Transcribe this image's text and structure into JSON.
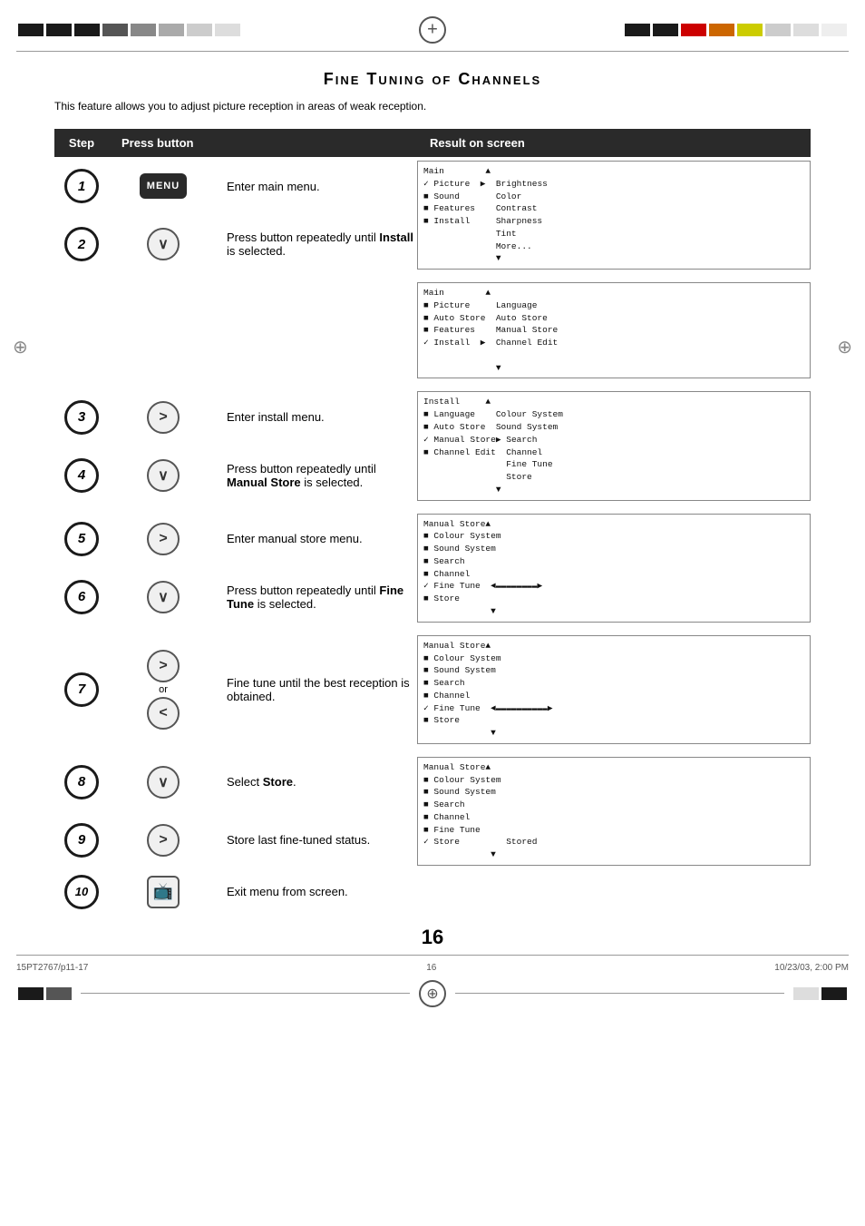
{
  "page": {
    "title": "Fine  Tuning of Channels",
    "subtitle": "This feature allows you to adjust picture reception in areas of weak reception.",
    "page_number": "16",
    "footer_left": "15PT2767/p11-17",
    "footer_center": "16",
    "footer_right": "10/23/03, 2:00 PM"
  },
  "header": {
    "col_step": "Step",
    "col_press": "Press button",
    "col_result": "Result on screen"
  },
  "steps": [
    {
      "num": "1",
      "button": "MENU",
      "button_type": "menu",
      "description": "Enter main menu.",
      "description_bold": "",
      "screen": "Main        ▲\n✓ Picture  ▶  Brightness\n■ Sound       Color\n■ Features    Contrast\n■ Install     Sharpness\n              Tint\n              More...\n              ▼"
    },
    {
      "num": "2",
      "button": "∨",
      "button_type": "round",
      "description": "Press button repeatedly until ",
      "description_bold": "Install",
      "description_suffix": " is selected.",
      "screen": "Main        ▲\n■ Picture     Language\n■ Auto Store  Auto Store\n■ Features    Manual Store\n✓ Install  ▶  Channel Edit\n\n              ▼"
    },
    {
      "num": "3",
      "button": ">",
      "button_type": "round",
      "description": "Enter install menu.",
      "description_bold": "",
      "screen": "Install     ▲\n■ Language    Colour System\n■ Auto Store  Sound System\n✓ Manual Store▶ Search\n■ Channel Edit  Channel\n                Fine Tune\n                Store\n              ▼"
    },
    {
      "num": "4",
      "button": "∨",
      "button_type": "round",
      "description": "Press button repeatedly until ",
      "description_bold": "Manual Store",
      "description_suffix": " is selected.",
      "screen": ""
    },
    {
      "num": "5",
      "button": ">",
      "button_type": "round",
      "description": "Enter manual store menu.",
      "description_bold": "",
      "screen": "Manual Store▲\n■ Colour System\n■ Sound System\n■ Search\n■ Channel\n✓ Fine Tune  ◄▬▬▬▬▬▬▬▬▶\n■ Store\n             ▼"
    },
    {
      "num": "6",
      "button": "∨",
      "button_type": "round",
      "description": "Press button repeatedly until ",
      "description_bold": "Fine Tune",
      "description_suffix": " is selected.",
      "screen": ""
    },
    {
      "num": "7",
      "button_primary": ">",
      "button_secondary": "<",
      "button_type": "double",
      "description": "Fine tune until the best reception is obtained.",
      "description_bold": "",
      "screen": "Manual Store▲\n■ Colour System\n■ Sound System\n■ Search\n■ Channel\n✓ Fine Tune  ◄▬▬▬▬▬▬▬▬▬▬▶\n■ Store\n             ▼"
    },
    {
      "num": "8",
      "button": "∨",
      "button_type": "round",
      "description": "Select ",
      "description_bold": "Store",
      "description_suffix": ".",
      "screen": "Manual Store▲\n■ Colour System\n■ Sound System\n■ Search\n■ Channel\n■ Fine Tune\n✓ Store         Stored\n             ▼"
    },
    {
      "num": "9",
      "button": ">",
      "button_type": "round",
      "description": "Store last fine-tuned status.",
      "description_bold": "",
      "screen": ""
    },
    {
      "num": "10",
      "button": "TV",
      "button_type": "tv",
      "description": "Exit menu from screen.",
      "description_bold": "",
      "screen": ""
    }
  ]
}
